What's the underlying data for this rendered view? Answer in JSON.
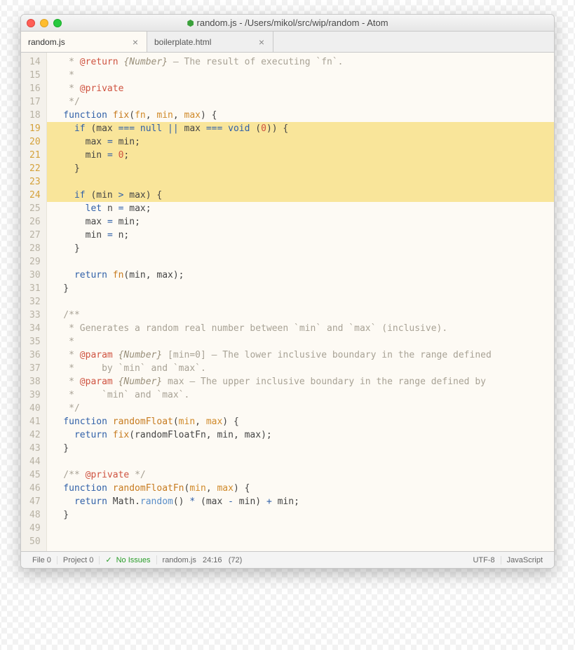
{
  "window": {
    "title": "random.js - /Users/mikol/src/wip/random - Atom"
  },
  "tabs": [
    {
      "label": "random.js",
      "active": true
    },
    {
      "label": "boilerplate.html",
      "active": false
    }
  ],
  "gutter": {
    "start": 14,
    "end": 50,
    "modified": [
      19,
      20,
      21,
      22,
      23,
      24
    ]
  },
  "code_lines": [
    {
      "n": 14,
      "hl": false,
      "segs": [
        {
          "c": "c-comment",
          "t": "   * "
        },
        {
          "c": "c-tag",
          "t": "@return"
        },
        {
          "c": "c-comment",
          "t": " "
        },
        {
          "c": "c-type",
          "t": "{Number}"
        },
        {
          "c": "c-comment",
          "t": " – The result of executing `fn`."
        }
      ]
    },
    {
      "n": 15,
      "hl": false,
      "segs": [
        {
          "c": "c-comment",
          "t": "   *"
        }
      ]
    },
    {
      "n": 16,
      "hl": false,
      "segs": [
        {
          "c": "c-comment",
          "t": "   * "
        },
        {
          "c": "c-tag",
          "t": "@private"
        }
      ]
    },
    {
      "n": 17,
      "hl": false,
      "segs": [
        {
          "c": "c-comment",
          "t": "   */"
        }
      ]
    },
    {
      "n": 18,
      "hl": false,
      "segs": [
        {
          "c": "c-kw",
          "t": "  function "
        },
        {
          "c": "c-fn",
          "t": "fix"
        },
        {
          "c": "c-ident",
          "t": "("
        },
        {
          "c": "c-param",
          "t": "fn"
        },
        {
          "c": "c-ident",
          "t": ", "
        },
        {
          "c": "c-param",
          "t": "min"
        },
        {
          "c": "c-ident",
          "t": ", "
        },
        {
          "c": "c-param",
          "t": "max"
        },
        {
          "c": "c-ident",
          "t": ") {"
        }
      ]
    },
    {
      "n": 19,
      "hl": true,
      "segs": [
        {
          "c": "c-kw",
          "t": "    if "
        },
        {
          "c": "c-ident",
          "t": "(max "
        },
        {
          "c": "c-op",
          "t": "=== "
        },
        {
          "c": "c-null",
          "t": "null"
        },
        {
          "c": "c-ident",
          "t": " "
        },
        {
          "c": "c-op",
          "t": "||"
        },
        {
          "c": "c-ident",
          "t": " max "
        },
        {
          "c": "c-op",
          "t": "=== "
        },
        {
          "c": "c-kw",
          "t": "void"
        },
        {
          "c": "c-ident",
          "t": " ("
        },
        {
          "c": "c-num",
          "t": "0"
        },
        {
          "c": "c-ident",
          "t": ")) {"
        }
      ]
    },
    {
      "n": 20,
      "hl": true,
      "segs": [
        {
          "c": "c-ident",
          "t": "      max "
        },
        {
          "c": "c-op",
          "t": "="
        },
        {
          "c": "c-ident",
          "t": " min;"
        }
      ]
    },
    {
      "n": 21,
      "hl": true,
      "segs": [
        {
          "c": "c-ident",
          "t": "      min "
        },
        {
          "c": "c-op",
          "t": "="
        },
        {
          "c": "c-ident",
          "t": " "
        },
        {
          "c": "c-num",
          "t": "0"
        },
        {
          "c": "c-ident",
          "t": ";"
        }
      ]
    },
    {
      "n": 22,
      "hl": true,
      "segs": [
        {
          "c": "c-ident",
          "t": "    }"
        }
      ]
    },
    {
      "n": 23,
      "hl": true,
      "segs": [
        {
          "c": "c-ident",
          "t": ""
        }
      ]
    },
    {
      "n": 24,
      "hl": true,
      "segs": [
        {
          "c": "c-kw",
          "t": "    if "
        },
        {
          "c": "c-ident",
          "t": "(min "
        },
        {
          "c": "c-op",
          "t": ">"
        },
        {
          "c": "c-ident",
          "t": " max) {"
        }
      ]
    },
    {
      "n": 25,
      "hl": false,
      "segs": [
        {
          "c": "c-kw",
          "t": "      let "
        },
        {
          "c": "c-ident",
          "t": "n "
        },
        {
          "c": "c-op",
          "t": "="
        },
        {
          "c": "c-ident",
          "t": " max;"
        }
      ]
    },
    {
      "n": 26,
      "hl": false,
      "segs": [
        {
          "c": "c-ident",
          "t": "      max "
        },
        {
          "c": "c-op",
          "t": "="
        },
        {
          "c": "c-ident",
          "t": " min;"
        }
      ]
    },
    {
      "n": 27,
      "hl": false,
      "segs": [
        {
          "c": "c-ident",
          "t": "      min "
        },
        {
          "c": "c-op",
          "t": "="
        },
        {
          "c": "c-ident",
          "t": " n;"
        }
      ]
    },
    {
      "n": 28,
      "hl": false,
      "segs": [
        {
          "c": "c-ident",
          "t": "    }"
        }
      ]
    },
    {
      "n": 29,
      "hl": false,
      "segs": [
        {
          "c": "c-ident",
          "t": ""
        }
      ]
    },
    {
      "n": 30,
      "hl": false,
      "segs": [
        {
          "c": "c-kw",
          "t": "    return "
        },
        {
          "c": "c-fn",
          "t": "fn"
        },
        {
          "c": "c-ident",
          "t": "(min, max);"
        }
      ]
    },
    {
      "n": 31,
      "hl": false,
      "segs": [
        {
          "c": "c-ident",
          "t": "  }"
        }
      ]
    },
    {
      "n": 32,
      "hl": false,
      "segs": [
        {
          "c": "c-ident",
          "t": ""
        }
      ]
    },
    {
      "n": 33,
      "hl": false,
      "segs": [
        {
          "c": "c-comment",
          "t": "  /**"
        }
      ]
    },
    {
      "n": 34,
      "hl": false,
      "segs": [
        {
          "c": "c-comment",
          "t": "   * Generates a random real number between `min` and `max` (inclusive)."
        }
      ]
    },
    {
      "n": 35,
      "hl": false,
      "segs": [
        {
          "c": "c-comment",
          "t": "   *"
        }
      ]
    },
    {
      "n": 36,
      "hl": false,
      "segs": [
        {
          "c": "c-comment",
          "t": "   * "
        },
        {
          "c": "c-tag",
          "t": "@param"
        },
        {
          "c": "c-comment",
          "t": " "
        },
        {
          "c": "c-type",
          "t": "{Number}"
        },
        {
          "c": "c-comment",
          "t": " [min=0] – The lower inclusive boundary in the range defined"
        }
      ]
    },
    {
      "n": 37,
      "hl": false,
      "segs": [
        {
          "c": "c-comment",
          "t": "   *     by `min` and `max`."
        }
      ]
    },
    {
      "n": 38,
      "hl": false,
      "segs": [
        {
          "c": "c-comment",
          "t": "   * "
        },
        {
          "c": "c-tag",
          "t": "@param"
        },
        {
          "c": "c-comment",
          "t": " "
        },
        {
          "c": "c-type",
          "t": "{Number}"
        },
        {
          "c": "c-comment",
          "t": " max – The upper inclusive boundary in the range defined by"
        }
      ]
    },
    {
      "n": 39,
      "hl": false,
      "segs": [
        {
          "c": "c-comment",
          "t": "   *     `min` and `max`."
        }
      ]
    },
    {
      "n": 40,
      "hl": false,
      "segs": [
        {
          "c": "c-comment",
          "t": "   */"
        }
      ]
    },
    {
      "n": 41,
      "hl": false,
      "segs": [
        {
          "c": "c-kw",
          "t": "  function "
        },
        {
          "c": "c-fn",
          "t": "randomFloat"
        },
        {
          "c": "c-ident",
          "t": "("
        },
        {
          "c": "c-param",
          "t": "min"
        },
        {
          "c": "c-ident",
          "t": ", "
        },
        {
          "c": "c-param",
          "t": "max"
        },
        {
          "c": "c-ident",
          "t": ") {"
        }
      ]
    },
    {
      "n": 42,
      "hl": false,
      "segs": [
        {
          "c": "c-kw",
          "t": "    return "
        },
        {
          "c": "c-fn",
          "t": "fix"
        },
        {
          "c": "c-ident",
          "t": "(randomFloatFn, min, max);"
        }
      ]
    },
    {
      "n": 43,
      "hl": false,
      "segs": [
        {
          "c": "c-ident",
          "t": "  }"
        }
      ]
    },
    {
      "n": 44,
      "hl": false,
      "segs": [
        {
          "c": "c-ident",
          "t": ""
        }
      ]
    },
    {
      "n": 45,
      "hl": false,
      "segs": [
        {
          "c": "c-comment",
          "t": "  /** "
        },
        {
          "c": "c-tag",
          "t": "@private"
        },
        {
          "c": "c-comment",
          "t": " */"
        }
      ]
    },
    {
      "n": 46,
      "hl": false,
      "segs": [
        {
          "c": "c-kw",
          "t": "  function "
        },
        {
          "c": "c-fn",
          "t": "randomFloatFn"
        },
        {
          "c": "c-ident",
          "t": "("
        },
        {
          "c": "c-param",
          "t": "min"
        },
        {
          "c": "c-ident",
          "t": ", "
        },
        {
          "c": "c-param",
          "t": "max"
        },
        {
          "c": "c-ident",
          "t": ") {"
        }
      ]
    },
    {
      "n": 47,
      "hl": false,
      "segs": [
        {
          "c": "c-kw",
          "t": "    return "
        },
        {
          "c": "c-ident",
          "t": "Math"
        },
        {
          "c": "c-ident",
          "t": "."
        },
        {
          "c": "c-prop",
          "t": "random"
        },
        {
          "c": "c-ident",
          "t": "() "
        },
        {
          "c": "c-op",
          "t": "*"
        },
        {
          "c": "c-ident",
          "t": " (max "
        },
        {
          "c": "c-op",
          "t": "-"
        },
        {
          "c": "c-ident",
          "t": " min) "
        },
        {
          "c": "c-op",
          "t": "+"
        },
        {
          "c": "c-ident",
          "t": " min;"
        }
      ]
    },
    {
      "n": 48,
      "hl": false,
      "segs": [
        {
          "c": "c-ident",
          "t": "  }"
        }
      ]
    },
    {
      "n": 49,
      "hl": false,
      "segs": [
        {
          "c": "c-ident",
          "t": ""
        }
      ]
    },
    {
      "n": 50,
      "hl": false,
      "segs": [
        {
          "c": "c-ident",
          "t": ""
        }
      ]
    }
  ],
  "status": {
    "file": "File 0",
    "project": "Project 0",
    "issues": "No Issues",
    "filename": "random.js",
    "cursor": "24:16",
    "length": "(72)",
    "encoding": "UTF-8",
    "language": "JavaScript"
  }
}
